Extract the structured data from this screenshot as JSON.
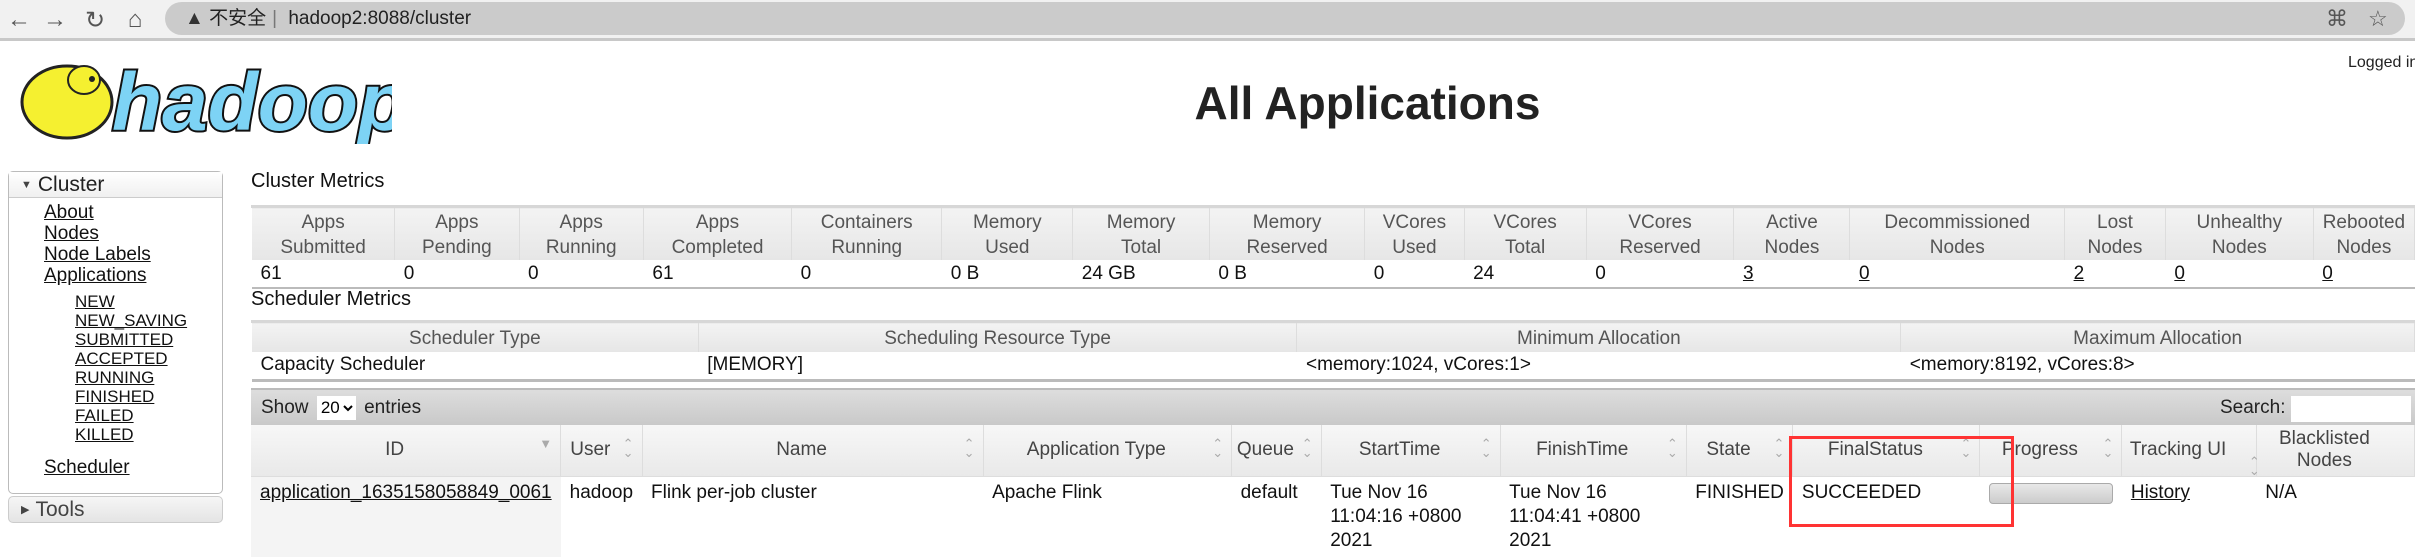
{
  "browser": {
    "insecure_label": "不安全",
    "url": "hadoop2:8088/cluster"
  },
  "header": {
    "title": "All Applications",
    "logged_in": "Logged in",
    "logo_text": "hadoop"
  },
  "sidebar": {
    "cluster_label": "Cluster",
    "links": [
      "About",
      "Nodes",
      "Node Labels",
      "Applications"
    ],
    "app_states": [
      "NEW",
      "NEW_SAVING",
      "SUBMITTED",
      "ACCEPTED",
      "RUNNING",
      "FINISHED",
      "FAILED",
      "KILLED"
    ],
    "scheduler": "Scheduler",
    "tools_label": "Tools"
  },
  "cluster_metrics": {
    "title": "Cluster Metrics",
    "headers": [
      [
        "Apps",
        "Submitted"
      ],
      [
        "Apps",
        "Pending"
      ],
      [
        "Apps",
        "Running"
      ],
      [
        "Apps",
        "Completed"
      ],
      [
        "Containers",
        "Running"
      ],
      [
        "Memory",
        "Used"
      ],
      [
        "Memory",
        "Total"
      ],
      [
        "Memory",
        "Reserved"
      ],
      [
        "VCores",
        "Used"
      ],
      [
        "VCores",
        "Total"
      ],
      [
        "VCores",
        "Reserved"
      ],
      [
        "Active",
        "Nodes"
      ],
      [
        "Decommissioned",
        "Nodes"
      ],
      [
        "Lost",
        "Nodes"
      ],
      [
        "Unhealthy",
        "Nodes"
      ],
      [
        "Rebooted",
        "Nodes"
      ]
    ],
    "values": [
      "61",
      "0",
      "0",
      "61",
      "0",
      "0 B",
      "24 GB",
      "0 B",
      "0",
      "24",
      "0",
      "3",
      "0",
      "2",
      "0",
      "0"
    ]
  },
  "scheduler_metrics": {
    "title": "Scheduler Metrics",
    "headers": [
      "Scheduler Type",
      "Scheduling Resource Type",
      "Minimum Allocation",
      "Maximum Allocation"
    ],
    "values": [
      "Capacity Scheduler",
      "[MEMORY]",
      "<memory:1024, vCores:1>",
      "<memory:8192, vCores:8>"
    ]
  },
  "apps_table": {
    "show_label": "Show",
    "entries_value": "20",
    "entries_label": "entries",
    "search_label": "Search:",
    "search_value": "",
    "headers": [
      "ID",
      "User",
      "Name",
      "Application Type",
      "Queue",
      "StartTime",
      "FinishTime",
      "State",
      "FinalStatus",
      "Progress",
      "Tracking UI",
      "Blacklisted Nodes"
    ],
    "rows": [
      {
        "id": "application_1635158058849_0061",
        "user": "hadoop",
        "name": "Flink per-job cluster",
        "type": "Apache Flink",
        "queue": "default",
        "start": "Tue Nov 16 11:04:16 +0800 2021",
        "finish": "Tue Nov 16 11:04:41 +0800 2021",
        "state": "FINISHED",
        "final_status": "SUCCEEDED",
        "progress": 0,
        "tracking": "History",
        "blacklisted": "N/A"
      }
    ]
  },
  "colors": {
    "highlight": "#ff3333",
    "logo_blue": "#7dd3f5",
    "logo_yellow": "#f5f030"
  }
}
